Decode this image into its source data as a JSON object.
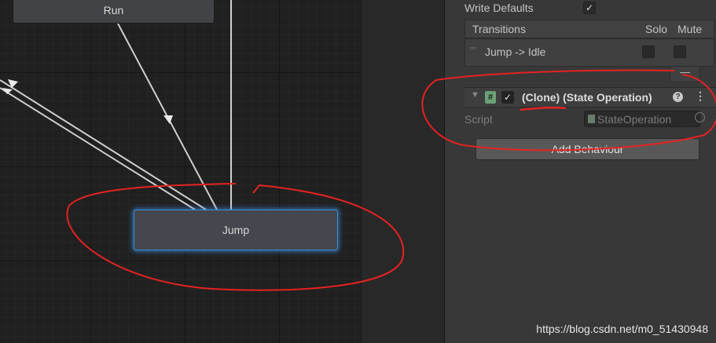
{
  "graph": {
    "states": {
      "run": "Run",
      "jump": "Jump"
    }
  },
  "inspector": {
    "write_defaults_label": "Write Defaults",
    "write_defaults_checked": true,
    "transitions": {
      "header": "Transitions",
      "solo": "Solo",
      "mute": "Mute",
      "items": [
        {
          "label": "Jump -> Idle",
          "solo": false,
          "mute": false
        }
      ],
      "remove_label": "—"
    },
    "component": {
      "enabled": true,
      "title": "(Clone) (State Operation)",
      "script_label": "Script",
      "script_value": "StateOperation"
    },
    "add_behaviour_label": "Add Behaviour"
  },
  "watermark": "https://blog.csdn.net/m0_51430948",
  "colors": {
    "annotation_red": "#e52222",
    "selection_blue": "#3c8ed8"
  }
}
